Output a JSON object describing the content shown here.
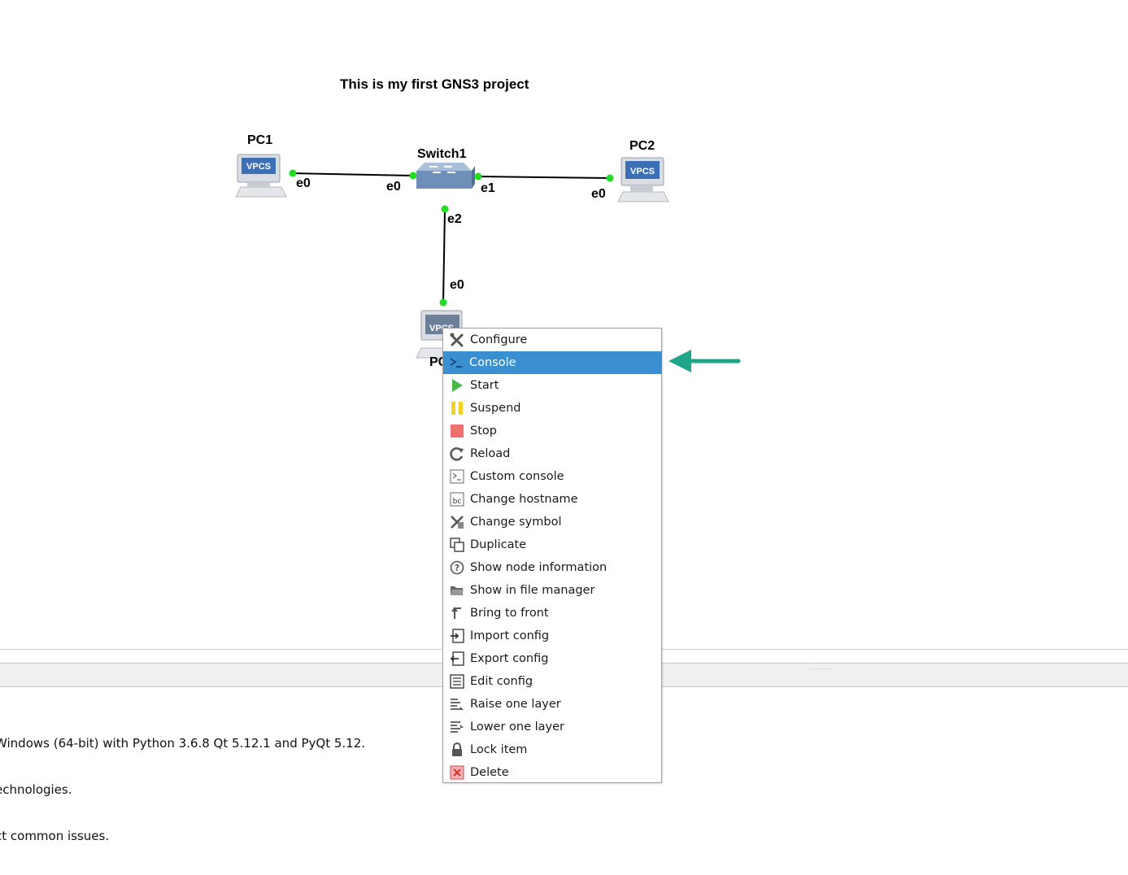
{
  "project": {
    "title": "This is my first GNS3 project"
  },
  "nodes": {
    "pc1": {
      "label": "PC1",
      "badge": "VPCS"
    },
    "pc2": {
      "label": "PC2",
      "badge": "VPCS"
    },
    "pc3": {
      "label": "PC",
      "badge": "VPCS"
    },
    "switch1": {
      "label": "Switch1"
    }
  },
  "ports": {
    "pc1_e0": "e0",
    "sw_e0": "e0",
    "sw_e1": "e1",
    "pc2_e0": "e0",
    "sw_e2": "e2",
    "pc3_e0": "e0"
  },
  "link_dot_color": "#22dd22",
  "context_menu": {
    "highlight_color": "#3a8fd0",
    "items": [
      {
        "label": "Configure",
        "icon": "wrench-screwdriver-icon"
      },
      {
        "label": "Console",
        "icon": "terminal-prompt-icon",
        "highlighted": true
      },
      {
        "label": "Start",
        "icon": "play-icon"
      },
      {
        "label": "Suspend",
        "icon": "pause-icon"
      },
      {
        "label": "Stop",
        "icon": "stop-icon"
      },
      {
        "label": "Reload",
        "icon": "reload-icon"
      },
      {
        "label": "Custom console",
        "icon": "custom-console-icon"
      },
      {
        "label": "Change hostname",
        "icon": "hostname-icon"
      },
      {
        "label": "Change symbol",
        "icon": "symbol-icon"
      },
      {
        "label": "Duplicate",
        "icon": "duplicate-icon"
      },
      {
        "label": "Show node information",
        "icon": "question-icon"
      },
      {
        "label": "Show in file manager",
        "icon": "folder-icon"
      },
      {
        "label": "Bring to front",
        "icon": "bring-front-icon"
      },
      {
        "label": "Import config",
        "icon": "import-icon"
      },
      {
        "label": "Export config",
        "icon": "export-icon"
      },
      {
        "label": "Edit config",
        "icon": "edit-config-icon"
      },
      {
        "label": "Raise one layer",
        "icon": "raise-layer-icon"
      },
      {
        "label": "Lower one layer",
        "icon": "lower-layer-icon"
      },
      {
        "label": "Lock item",
        "icon": "lock-icon"
      },
      {
        "label": "Delete",
        "icon": "delete-icon"
      }
    ]
  },
  "console": {
    "lines": [
      "Windows (64-bit) with Python 3.6.8 Qt 5.12.1 and PyQt 5.12.",
      "echnologies.",
      "ct common issues."
    ]
  },
  "annotation_arrow_color": "#1fa58a"
}
